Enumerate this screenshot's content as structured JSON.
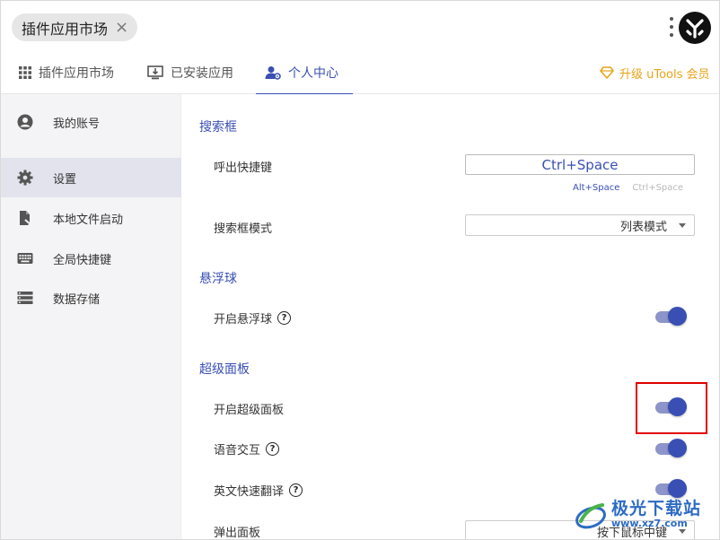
{
  "titlebar": {
    "tab_label": "插件应用市场",
    "close_glyph": "×"
  },
  "tabs": [
    {
      "label": "插件应用市场",
      "icon": "grid-icon"
    },
    {
      "label": "已安装应用",
      "icon": "install-icon"
    },
    {
      "label": "个人中心",
      "icon": "user-settings-icon",
      "active": true
    }
  ],
  "upgrade": {
    "label": "升级 uTools 会员",
    "color": "#e8a317"
  },
  "sidebar": {
    "items": [
      {
        "label": "我的账号",
        "icon": "account-icon"
      },
      {
        "label": "设置",
        "icon": "gear-icon",
        "active": true
      },
      {
        "label": "本地文件启动",
        "icon": "file-launch-icon"
      },
      {
        "label": "全局快捷键",
        "icon": "keyboard-icon"
      },
      {
        "label": "数据存储",
        "icon": "storage-icon"
      }
    ]
  },
  "content": {
    "search_section": {
      "title": "搜索框",
      "hotkey_label": "呼出快捷键",
      "hotkey_value": "Ctrl+Space",
      "hint_active": "Alt+Space",
      "hint_inactive": "Ctrl+Space",
      "mode_label": "搜索框模式",
      "mode_value": "列表模式"
    },
    "float_section": {
      "title": "悬浮球",
      "enable_label": "开启悬浮球",
      "enable_on": true
    },
    "super_section": {
      "title": "超级面板",
      "enable_label": "开启超级面板",
      "enable_on": true,
      "voice_label": "语音交互",
      "voice_on": true,
      "translate_label": "英文快速翻译",
      "translate_on": true,
      "popup_label": "弹出面板",
      "popup_value": "按下鼠标中键"
    }
  },
  "colors": {
    "accent": "#3a4fb4",
    "highlight": "#e00000"
  },
  "watermark": {
    "cn": "极光下载站",
    "url": "www.xz7.com"
  }
}
